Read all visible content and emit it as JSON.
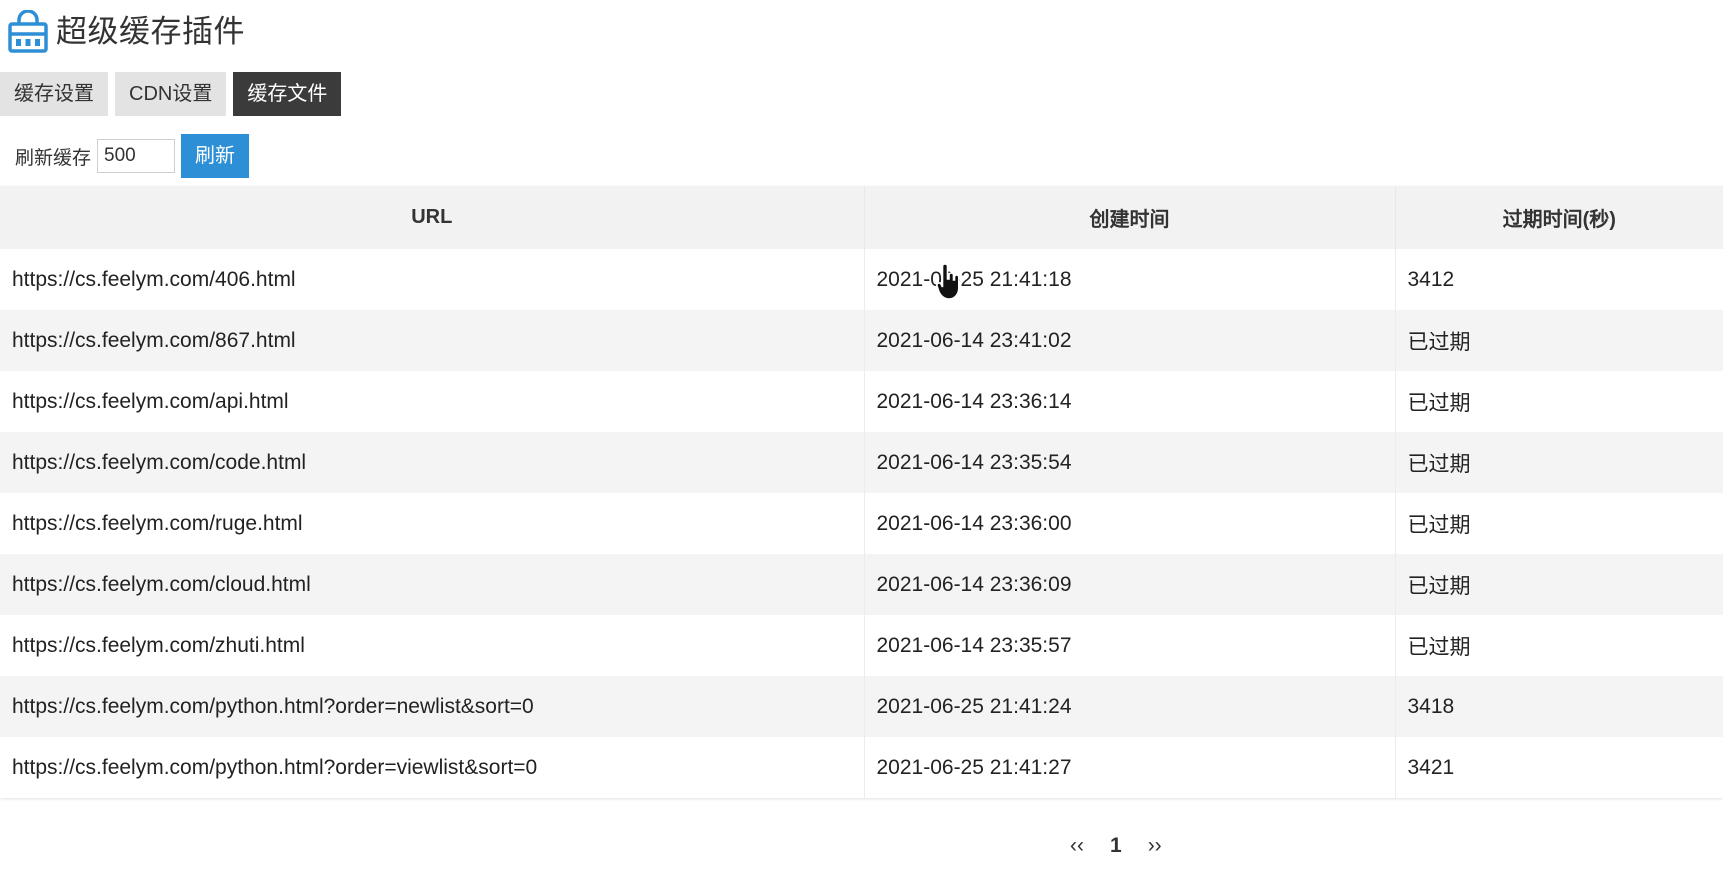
{
  "header": {
    "title": "超级缓存插件",
    "icon": "basket-icon",
    "accent": "#2d8fd6"
  },
  "tabs": [
    {
      "label": "缓存设置",
      "active": false
    },
    {
      "label": "CDN设置",
      "active": false
    },
    {
      "label": "缓存文件",
      "active": true
    }
  ],
  "refresh": {
    "label": "刷新缓存",
    "value": "500",
    "button_label": "刷新"
  },
  "table": {
    "columns": [
      "URL",
      "创建时间",
      "过期时间(秒)"
    ],
    "rows": [
      {
        "url": "https://cs.feelym.com/406.html",
        "created": "2021-06-25 21:41:18",
        "expire": "3412"
      },
      {
        "url": "https://cs.feelym.com/867.html",
        "created": "2021-06-14 23:41:02",
        "expire": "已过期"
      },
      {
        "url": "https://cs.feelym.com/api.html",
        "created": "2021-06-14 23:36:14",
        "expire": "已过期"
      },
      {
        "url": "https://cs.feelym.com/code.html",
        "created": "2021-06-14 23:35:54",
        "expire": "已过期"
      },
      {
        "url": "https://cs.feelym.com/ruge.html",
        "created": "2021-06-14 23:36:00",
        "expire": "已过期"
      },
      {
        "url": "https://cs.feelym.com/cloud.html",
        "created": "2021-06-14 23:36:09",
        "expire": "已过期"
      },
      {
        "url": "https://cs.feelym.com/zhuti.html",
        "created": "2021-06-14 23:35:57",
        "expire": "已过期"
      },
      {
        "url": "https://cs.feelym.com/python.html?order=newlist&sort=0",
        "created": "2021-06-25 21:41:24",
        "expire": "3418"
      },
      {
        "url": "https://cs.feelym.com/python.html?order=viewlist&sort=0",
        "created": "2021-06-25 21:41:27",
        "expire": "3421"
      }
    ]
  },
  "pagination": {
    "prev": "‹‹",
    "current": "1",
    "next": "››"
  }
}
